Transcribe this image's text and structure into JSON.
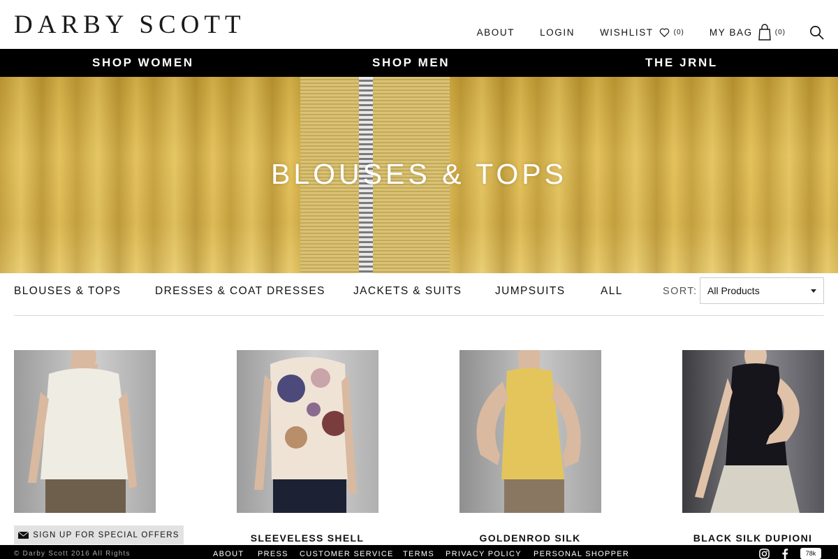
{
  "header": {
    "logo": "DARBY SCOTT",
    "about": "ABOUT",
    "login": "LOGIN",
    "wishlist": "WISHLIST",
    "wishlist_count": "(0)",
    "bag": "MY BAG",
    "bag_count": "(0)"
  },
  "nav": {
    "shop_women": "SHOP WOMEN",
    "shop_men": "SHOP MEN",
    "journal": "THE JRNL"
  },
  "hero": {
    "title": "BLOUSES & TOPS"
  },
  "categories": [
    "BLOUSES & TOPS",
    "DRESSES & COAT DRESSES",
    "JACKETS & SUITS",
    "JUMPSUITS",
    "ALL"
  ],
  "sort": {
    "label": "SORT:",
    "value": "All Products"
  },
  "products": [
    {
      "name": "",
      "top_color": "#efece3",
      "bottom_color": "#6e5f4c"
    },
    {
      "name": "SLEEVELESS SHELL",
      "top_color": "#efe3d6",
      "bottom_color": "#1c2233"
    },
    {
      "name": "GOLDENROD SILK",
      "top_color": "#e3c55c",
      "bottom_color": "#8a7762"
    },
    {
      "name": "BLACK SILK DUPIONI",
      "top_color": "#15151b",
      "bottom_color": "#d6d2c6"
    }
  ],
  "signup": {
    "label": "SIGN UP FOR SPECIAL OFFERS"
  },
  "footer": {
    "copyright": "© Darby Scott 2016 All Rights",
    "links": [
      "ABOUT",
      "PRESS",
      "CUSTOMER SERVICE",
      "TERMS",
      "PRIVACY POLICY",
      "PERSONAL SHOPPER"
    ],
    "social_count": "78k"
  },
  "colors": {
    "accent": "#000000",
    "hero_gold": "#d8b44d"
  }
}
